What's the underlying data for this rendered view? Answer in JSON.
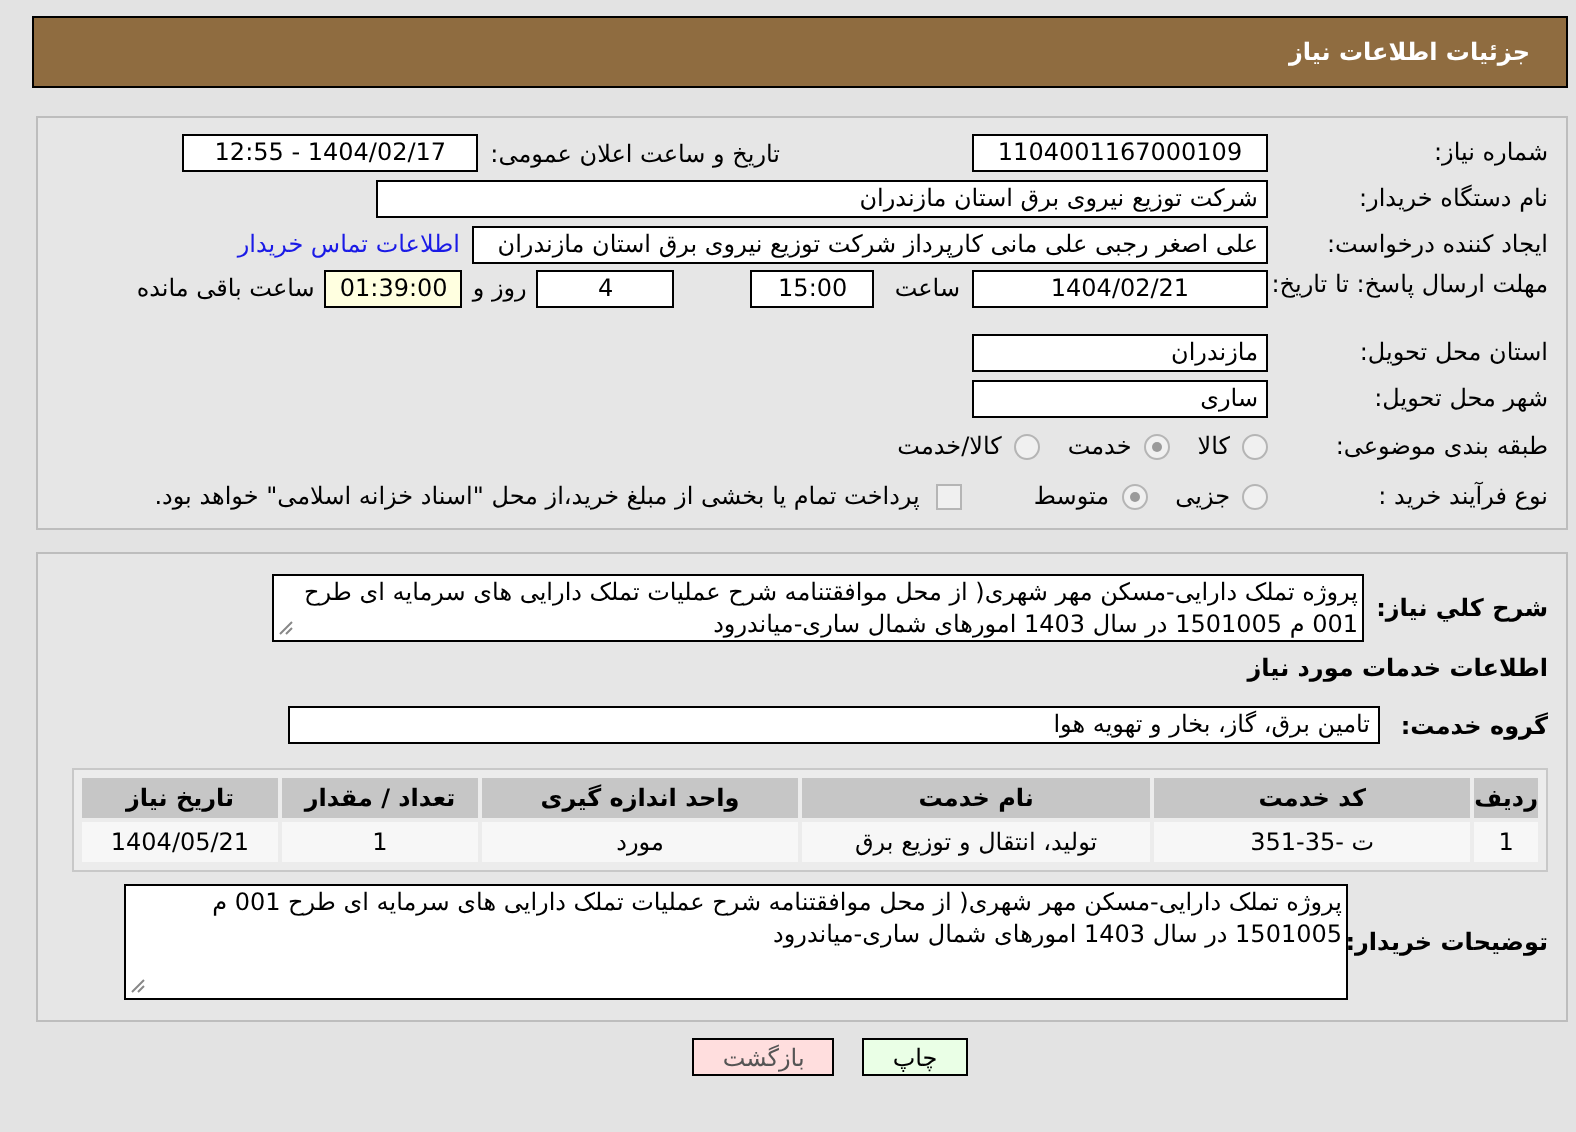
{
  "header": {
    "title": "جزئیات اطلاعات نیاز"
  },
  "need_number": {
    "label": "شماره نیاز:",
    "value": "1104001167000109"
  },
  "announce": {
    "label": "تاریخ و ساعت اعلان عمومی:",
    "value": "1404/02/17 - 12:55"
  },
  "buyer_org": {
    "label": "نام دستگاه خریدار:",
    "value": "شرکت توزیع نیروی برق استان مازندران"
  },
  "creator": {
    "label": "ایجاد کننده درخواست:",
    "value": "علی اصغر رجبی علی مانی کارپرداز شرکت توزیع نیروی برق استان مازندران",
    "link": "اطلاعات تماس خریدار"
  },
  "deadline": {
    "label": "مهلت ارسال پاسخ: تا تاریخ:",
    "date": "1404/02/21",
    "time_label": "ساعت",
    "time": "15:00",
    "days": "4",
    "days_label": "روز و",
    "remaining": "01:39:00",
    "remaining_label": "ساعت باقی مانده"
  },
  "province": {
    "label": "استان محل تحویل:",
    "value": "مازندران"
  },
  "city": {
    "label": "شهر محل تحویل:",
    "value": "ساری"
  },
  "category": {
    "label": "طبقه بندی موضوعی:",
    "options": [
      {
        "label": "کالا",
        "selected": false
      },
      {
        "label": "خدمت",
        "selected": true
      },
      {
        "label": "کالا/خدمت",
        "selected": false
      }
    ]
  },
  "process": {
    "label": "نوع فرآیند خرید :",
    "options": [
      {
        "label": "جزیی",
        "selected": false
      },
      {
        "label": "متوسط",
        "selected": true
      }
    ],
    "payment": {
      "checked": false,
      "text": "پرداخت تمام یا بخشی از مبلغ خرید،از محل \"اسناد خزانه اسلامی\" خواهد بود."
    }
  },
  "summary": {
    "label": "شرح كلي نياز:",
    "value": "پروژه تملک دارایی-مسکن مهر شهری( از محل موافقتنامه شرح عملیات تملک دارایی های سرمایه ای طرح 001 م 1501005 در سال 1403 امورهای شمال ساری-میاندرود"
  },
  "services_heading": "اطلاعات خدمات مورد نیاز",
  "service_group": {
    "label": "گروه خدمت:",
    "value": "تامین برق، گاز، بخار و تهویه هوا"
  },
  "table": {
    "columns": [
      "ردیف",
      "کد خدمت",
      "نام خدمت",
      "واحد اندازه گیری",
      "تعداد / مقدار",
      "تاریخ نیاز"
    ],
    "rows": [
      [
        "1",
        "ت -35-351",
        "تولید، انتقال و توزیع برق",
        "مورد",
        "1",
        "1404/05/21"
      ]
    ]
  },
  "buyer_notes": {
    "label": "توضیحات خریدار:",
    "value": "پروژه تملک دارایی-مسکن مهر شهری( از محل موافقتنامه شرح عملیات تملک دارایی های سرمایه ای طرح 001 م 1501005 در سال 1403 امورهای شمال ساری-میاندرود"
  },
  "buttons": [
    {
      "kind": "print",
      "label": "چاپ"
    },
    {
      "kind": "back",
      "label": "بازگشت"
    }
  ]
}
